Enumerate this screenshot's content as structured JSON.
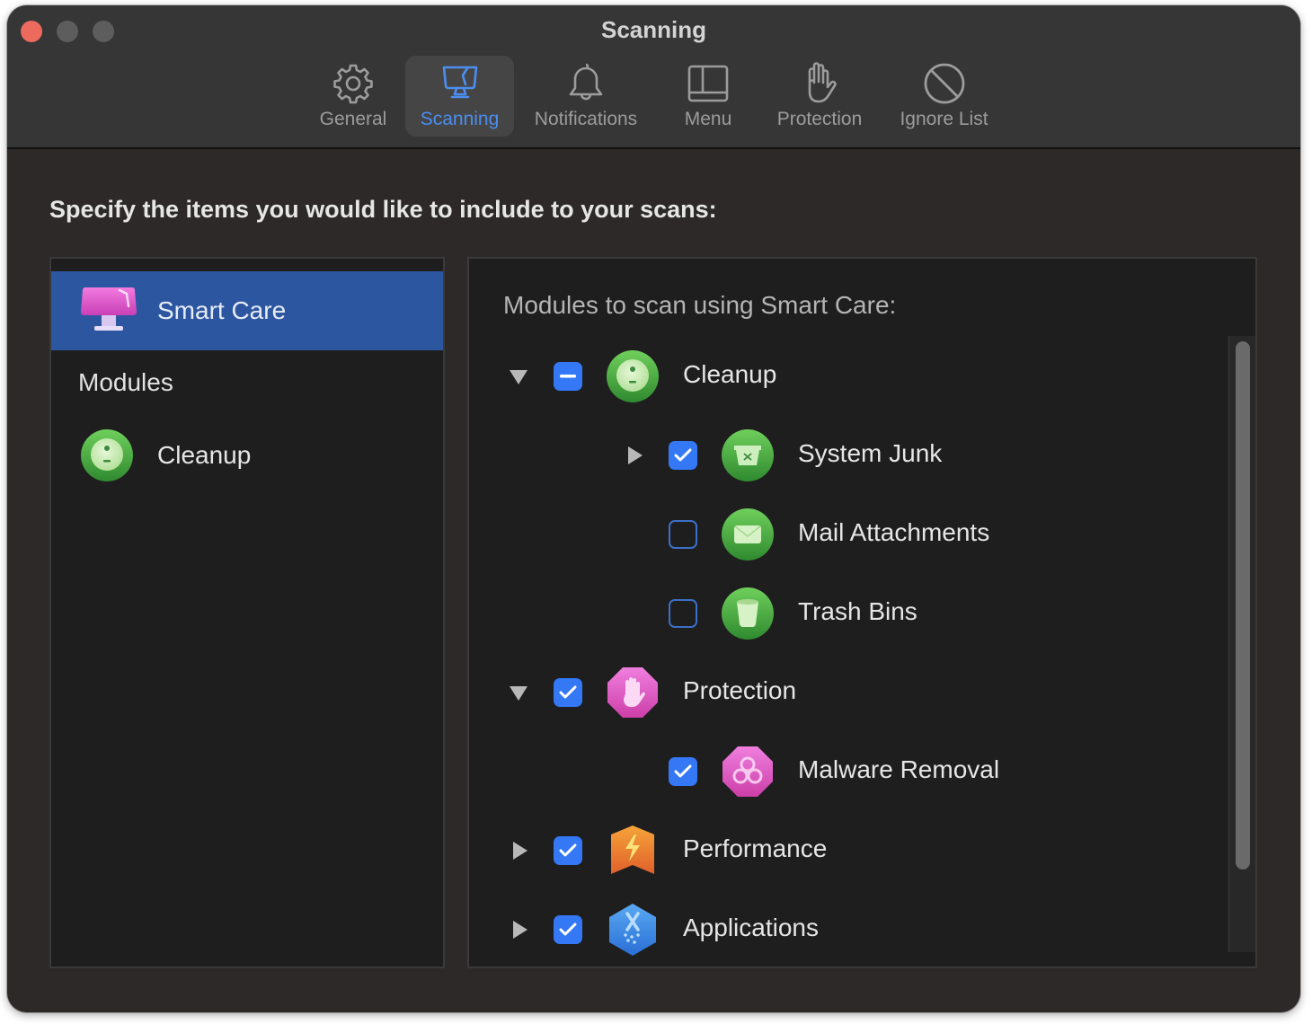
{
  "window": {
    "title": "Scanning",
    "traffic_lights": [
      "close",
      "minimize",
      "zoom"
    ]
  },
  "toolbar": {
    "tabs": [
      {
        "label": "General",
        "icon": "gear-icon",
        "active": false
      },
      {
        "label": "Scanning",
        "icon": "monitor-icon",
        "active": true
      },
      {
        "label": "Notifications",
        "icon": "bell-icon",
        "active": false
      },
      {
        "label": "Menu",
        "icon": "menu-layout-icon",
        "active": false
      },
      {
        "label": "Protection",
        "icon": "hand-icon",
        "active": false
      },
      {
        "label": "Ignore List",
        "icon": "prohibited-icon",
        "active": false
      }
    ],
    "active_color": "#4b8ef0"
  },
  "heading": "Specify the items you would like to include to your scans:",
  "sidebar": {
    "selected": {
      "label": "Smart Care",
      "icon": "smart-care-icon"
    },
    "section_label": "Modules",
    "items": [
      {
        "label": "Cleanup",
        "icon": "cleanup-icon"
      }
    ],
    "selection_color": "#2d56a0"
  },
  "modules_panel": {
    "caption": "Modules to scan using Smart Care:",
    "tree": [
      {
        "label": "Cleanup",
        "icon": "cleanup-icon",
        "level": 0,
        "expanded": true,
        "check": "mixed"
      },
      {
        "label": "System Junk",
        "icon": "system-junk-icon",
        "level": 1,
        "expandable": true,
        "expanded": false,
        "check": "on"
      },
      {
        "label": "Mail Attachments",
        "icon": "mail-attachments-icon",
        "level": 1,
        "check": "off"
      },
      {
        "label": "Trash Bins",
        "icon": "trash-bins-icon",
        "level": 1,
        "check": "off"
      },
      {
        "label": "Protection",
        "icon": "protection-icon",
        "level": 0,
        "expanded": true,
        "check": "on"
      },
      {
        "label": "Malware Removal",
        "icon": "malware-removal-icon",
        "level": 1,
        "check": "on"
      },
      {
        "label": "Performance",
        "icon": "performance-icon",
        "level": 0,
        "expanded": false,
        "check": "on"
      },
      {
        "label": "Applications",
        "icon": "applications-icon",
        "level": 0,
        "expanded": false,
        "check": "on"
      }
    ],
    "checkbox_color": "#3478f6"
  }
}
